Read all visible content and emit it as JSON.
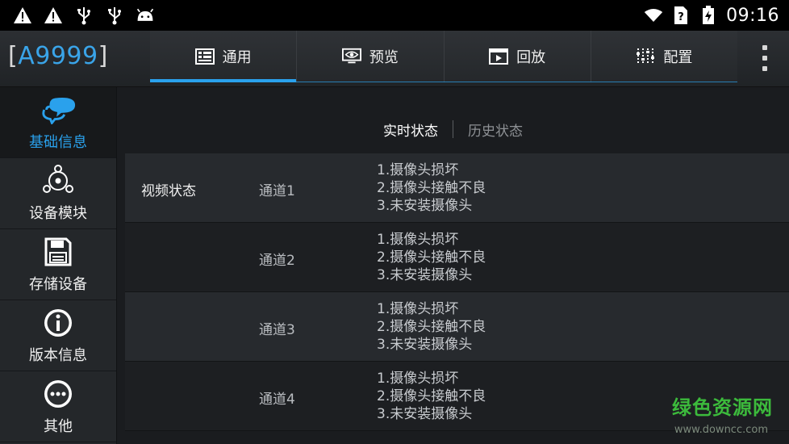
{
  "status_bar": {
    "left_icons": [
      "warning-icon",
      "warning-icon",
      "usb-icon",
      "usb-icon",
      "android-icon"
    ],
    "time": "09:16"
  },
  "header": {
    "logo_text": "A9999",
    "tabs": [
      {
        "label": "通用",
        "icon": "grid-icon",
        "active": true
      },
      {
        "label": "预览",
        "icon": "monitor-eye-icon",
        "active": false
      },
      {
        "label": "回放",
        "icon": "playback-icon",
        "active": false
      },
      {
        "label": "配置",
        "icon": "sliders-icon",
        "active": false
      }
    ]
  },
  "sidebar": {
    "items": [
      {
        "label": "基础信息",
        "icon": "chat-bubble-icon",
        "active": true
      },
      {
        "label": "设备模块",
        "icon": "module-icon",
        "active": false
      },
      {
        "label": "存储设备",
        "icon": "floppy-disk-icon",
        "active": false
      },
      {
        "label": "版本信息",
        "icon": "info-icon",
        "active": false
      },
      {
        "label": "其他",
        "icon": "more-icon",
        "active": false
      }
    ]
  },
  "main": {
    "subtabs": {
      "realtime": "实时状态",
      "history": "历史状态"
    },
    "section_label": "视频状态",
    "channels": [
      {
        "name": "通道1",
        "errors": [
          "1.摄像头损坏",
          "2.摄像头接触不良",
          "3.未安装摄像头"
        ]
      },
      {
        "name": "通道2",
        "errors": [
          "1.摄像头损坏",
          "2.摄像头接触不良",
          "3.未安装摄像头"
        ]
      },
      {
        "name": "通道3",
        "errors": [
          "1.摄像头损坏",
          "2.摄像头接触不良",
          "3.未安装摄像头"
        ]
      },
      {
        "name": "通道4",
        "errors": [
          "1.摄像头损坏",
          "2.摄像头接触不良",
          "3.未安装摄像头"
        ]
      }
    ]
  },
  "watermark": {
    "text": "绿色资源网",
    "url": "www.downcc.com"
  },
  "colors": {
    "accent": "#2aa1ec",
    "watermark": "#3cba3c"
  }
}
